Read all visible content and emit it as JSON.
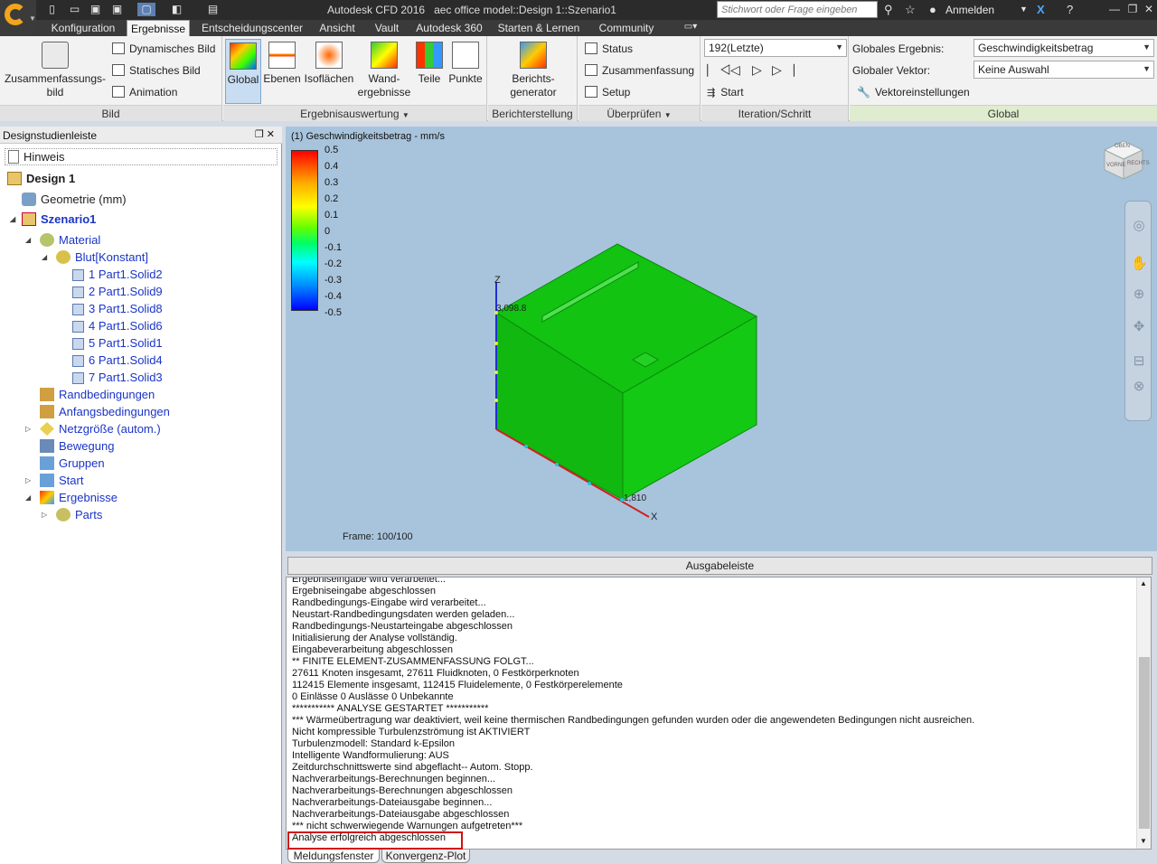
{
  "titlebar": {
    "app": "Autodesk CFD 2016",
    "doc": "aec office model::Design 1::Szenario1",
    "search_placeholder": "Stichwort oder Frage eingeben",
    "login": "Anmelden"
  },
  "menu_tabs": [
    "Konfiguration",
    "Ergebnisse",
    "Entscheidungscenter",
    "Ansicht",
    "Vault",
    "Autodesk 360",
    "Starten & Lernen",
    "Community"
  ],
  "ribbon": {
    "bild": {
      "label": "Bild",
      "big_button": "Zusammenfassungs-bild",
      "buttons": [
        "Dynamisches Bild",
        "Statisches Bild",
        "Animation"
      ]
    },
    "ergebnis": {
      "label": "Ergebnisauswertung",
      "buttons": [
        "Global",
        "Ebenen",
        "Isoflächen",
        "Wand-ergebnisse",
        "Teile",
        "Punkte"
      ]
    },
    "bericht": {
      "label": "Berichterstellung",
      "button": "Berichts-generator"
    },
    "pruefen": {
      "label": "Überprüfen",
      "buttons": [
        "Status",
        "Zusammenfassung",
        "Setup"
      ]
    },
    "iteration": {
      "label": "Iteration/Schritt",
      "select": "192(Letzte)",
      "start": "Start"
    },
    "global": {
      "label": "Global",
      "ergebnis_label": "Globales Ergebnis:",
      "ergebnis_value": "Geschwindigkeitsbetrag",
      "vektor_label": "Globaler Vektor:",
      "vektor_value": "Keine Auswahl",
      "vektor_settings": "Vektoreinstellungen"
    }
  },
  "panel": {
    "title": "Designstudienleiste",
    "hint": "Hinweis",
    "tree": {
      "design": "Design 1",
      "geometrie": "Geometrie (mm)",
      "szenario": "Szenario1",
      "material": "Material",
      "blut": "Blut[Konstant]",
      "parts": [
        "1 Part1.Solid2",
        "2 Part1.Solid9",
        "3 Part1.Solid8",
        "4 Part1.Solid6",
        "5 Part1.Solid1",
        "6 Part1.Solid4",
        "7 Part1.Solid3"
      ],
      "randbedingungen": "Randbedingungen",
      "anfangsbedingungen": "Anfangsbedingungen",
      "netzgroesse": "Netzgröße (autom.)",
      "bewegung": "Bewegung",
      "gruppen": "Gruppen",
      "start": "Start",
      "ergebnisse": "Ergebnisse",
      "parts_node": "Parts"
    }
  },
  "viewport": {
    "legend_title": "(1) Geschwindigkeitsbetrag - mm/s",
    "scale": [
      "0.5",
      "0.4",
      "0.3",
      "0.2",
      "0.1",
      "0",
      "-0.1",
      "-0.2",
      "-0.3",
      "-0.4",
      "-0.5"
    ],
    "axis_z": "Z",
    "axis_x": "X",
    "dim_z": "3,098.8",
    "dim_x": "1,810",
    "frame": "Frame: 100/100",
    "cube_labels": [
      "OBEN",
      "VORNE",
      "RECHTS"
    ],
    "model_color": "#13c513"
  },
  "output": {
    "header": "Ausgabeleiste",
    "lines": [
      "Ergebniseingabe wird verarbeitet...",
      "Ergebniseingabe abgeschlossen",
      "Randbedingungs-Eingabe wird verarbeitet...",
      "Neustart-Randbedingungsdaten werden geladen...",
      "Randbedingungs-Neustarteingabe abgeschlossen",
      "Initialisierung der Analyse vollständig.",
      "Eingabeverarbeitung abgeschlossen",
      "** FINITE ELEMENT-ZUSAMMENFASSUNG FOLGT...",
      "27611 Knoten insgesamt,    27611 Fluidknoten,    0 Festkörperknoten",
      "112415 Elemente insgesamt,    112415 Fluidelemente,    0 Festkörperelemente",
      "0 Einlässe    0 Auslässe    0 Unbekannte",
      "*********** ANALYSE GESTARTET ***********",
      "*** Wärmeübertragung war deaktiviert, weil keine thermischen Randbedingungen gefunden wurden oder die angewendeten Bedingungen nicht ausreichen.",
      "Nicht kompressible Turbulenzströmung ist AKTIVIERT",
      "Turbulenzmodell: Standard k-Epsilon",
      "Intelligente Wandformulierung: AUS",
      "Zeitdurchschnittswerte sind abgeflacht-- Autom. Stopp.",
      "Nachverarbeitungs-Berechnungen beginnen...",
      "Nachverarbeitungs-Berechnungen abgeschlossen",
      "Nachverarbeitungs-Dateiausgabe beginnen...",
      "Nachverarbeitungs-Dateiausgabe abgeschlossen",
      "*** nicht schwerwiegende Warnungen aufgetreten***",
      "Analyse erfolgreich abgeschlossen"
    ],
    "tabs": [
      "Meldungsfenster",
      "Konvergenz-Plot"
    ]
  }
}
